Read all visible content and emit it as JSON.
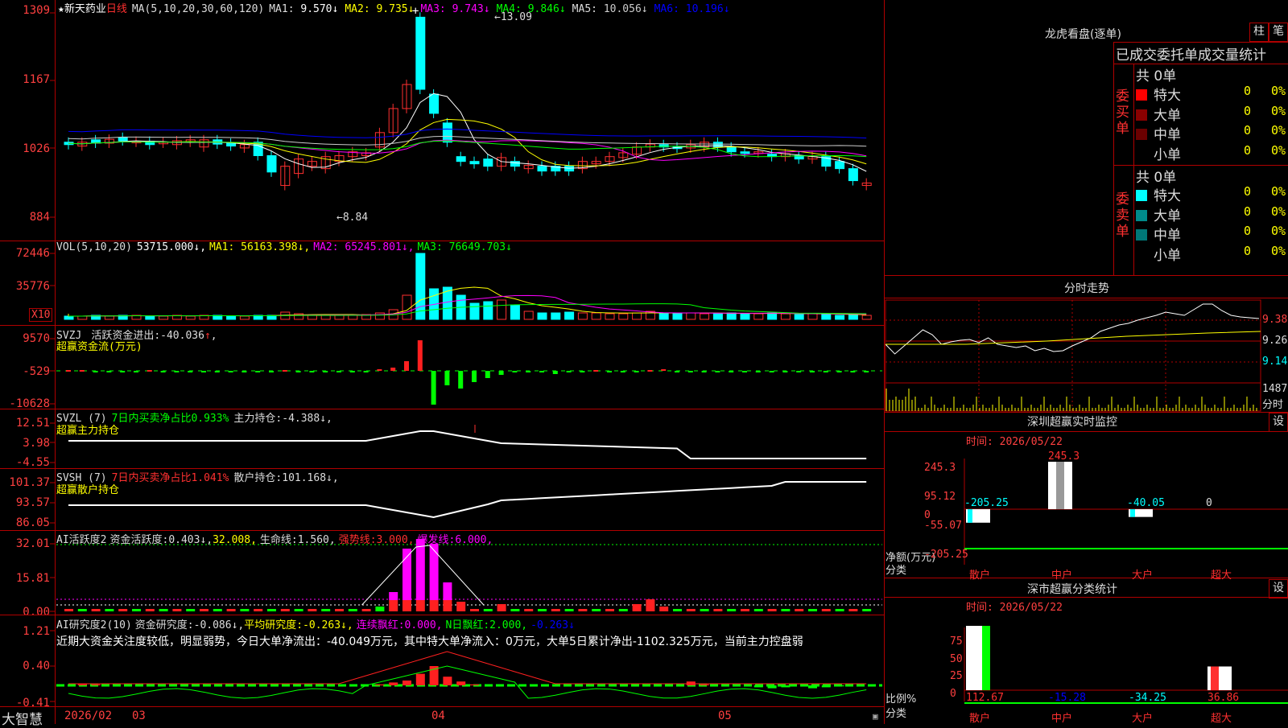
{
  "stock": {
    "star": "★",
    "name": "新天药业",
    "period": "日线"
  },
  "main_legend": {
    "ma_params": "MA(5,10,20,30,60,120)",
    "items": [
      {
        "label": "MA1:",
        "value": "9.570↓",
        "color": "#ffffff"
      },
      {
        "label": "MA2:",
        "value": "9.735↓",
        "color": "#ffff00"
      },
      {
        "label": "MA3:",
        "value": "9.743↓",
        "color": "#ff00ff"
      },
      {
        "label": "MA4:",
        "value": "9.846↓",
        "color": "#00ff00"
      },
      {
        "label": "MA5:",
        "value": "10.056↓",
        "color": "#cccccc"
      },
      {
        "label": "MA6:",
        "value": "10.196↓",
        "color": "#0000ff"
      }
    ],
    "high_mark": "13.09",
    "low_mark": "8.84"
  },
  "main_axis": [
    "1309",
    "1167",
    "1026",
    "884"
  ],
  "vol_legend": {
    "params": "VOL(5,10,20)",
    "value": "53715.000↓,",
    "items": [
      {
        "label": "MA1:",
        "value": "56163.398↓,",
        "color": "#ffff00"
      },
      {
        "label": "MA2:",
        "value": "65245.801↓,",
        "color": "#ff00ff"
      },
      {
        "label": "MA3:",
        "value": "76649.703↓",
        "color": "#00ff00"
      }
    ]
  },
  "vol_axis": [
    "72446",
    "35776"
  ],
  "vol_multiplier": "X10",
  "svzj": {
    "name": "SVZJ",
    "label": "活跃资金进出:",
    "value": "-40.036",
    "arrow": "↑",
    "comma": ",",
    "title": "超赢资金流(万元)"
  },
  "svzj_axis": [
    "9570",
    "-529",
    "-10628"
  ],
  "svzl": {
    "name": "SVZL (7)",
    "ratio": "7日内买卖净占比0.933%",
    "label": "主力持仓:",
    "value": "-4.388↓,",
    "title": "超赢主力持仓"
  },
  "svzl_axis": [
    "12.51",
    "3.98",
    "-4.55"
  ],
  "svsh": {
    "name": "SVSH (7)",
    "ratio": "7日内买卖净占比1.041%",
    "label": "散户持仓:",
    "value": "101.168↓,",
    "title": "超赢散户持仓"
  },
  "svsh_axis": [
    "101.37",
    "93.57",
    "86.05"
  ],
  "ai_active": {
    "name": "AI活跃度2",
    "label": "资金活跃度:",
    "value": "0.403↓,",
    "v2": "32.008,",
    "life_label": "生命线:",
    "life_value": "1.560,",
    "strong_label": "强势线:",
    "strong_value": "3.000,",
    "burst_label": "爆发线:",
    "burst_value": "6.000,"
  },
  "ai_active_axis": [
    "32.01",
    "15.81",
    "0.00"
  ],
  "ai_research": {
    "name": "AI研究度2(10)",
    "label": "资金研究度:",
    "value": "-0.086↓,",
    "avg_label": "平均研究度:",
    "avg_value": "-0.263↓,",
    "red_label": "连续飘红:",
    "red_value": "0.000,",
    "nred_label": "N日飘红:",
    "nred_value": "2.000,",
    "last": "-0.263↓",
    "comment": "近期大资金关注度较低，明显弱势，今日大单净流出：-40.049万元，其中特大单净流入：0万元，大单5日累计净出-1102.325万元，当前主力控盘弱"
  },
  "ai_research_axis": [
    "1.21",
    "0.40",
    "-0.41"
  ],
  "bottom": {
    "brand": "大智慧",
    "dates": [
      "2026/02",
      "03",
      "04",
      "05"
    ]
  },
  "dragon": {
    "title": "龙虎看盘(逐单)",
    "btn1": "柱",
    "btn2": "笔",
    "subtitle": "已成交委托单成交量统计",
    "buy_label": "委买单",
    "sell_label": "委卖单",
    "buy_total": "共 0单",
    "sell_total": "共 0单",
    "buy_rows": [
      {
        "name": "特大",
        "qty": "0",
        "pct": "0%",
        "color": "#ff0000"
      },
      {
        "name": "大单",
        "qty": "0",
        "pct": "0%",
        "color": "#8b0000"
      },
      {
        "name": "中单",
        "qty": "0",
        "pct": "0%",
        "color": "#6b0000"
      },
      {
        "name": "小单",
        "qty": "0",
        "pct": "0%",
        "color": ""
      }
    ],
    "sell_rows": [
      {
        "name": "特大",
        "qty": "0",
        "pct": "0%",
        "color": "#00ffff"
      },
      {
        "name": "大单",
        "qty": "0",
        "pct": "0%",
        "color": "#008b8b"
      },
      {
        "name": "中单",
        "qty": "0",
        "pct": "0%",
        "color": "#007777"
      },
      {
        "name": "小单",
        "qty": "0",
        "pct": "0%",
        "color": ""
      }
    ]
  },
  "intraday": {
    "title": "分时走势",
    "prices": [
      "9.38",
      "9.26",
      "9.14"
    ],
    "vol": "1487",
    "unit": "分时"
  },
  "monitor": {
    "title": "深圳超赢实时监控",
    "btn": "设",
    "date": "时间: 2026/05/22",
    "axis": [
      "245.3",
      "95.12",
      "0",
      "-55.07",
      "-205.25"
    ],
    "ylabel": "净额(万元)",
    "xlabel": "分类",
    "cats": [
      "散户",
      "中户",
      "大户",
      "超大"
    ],
    "values": [
      -205.25,
      245.3,
      -40.05,
      0
    ],
    "labels": [
      "-205.25",
      "245.3",
      "-40.05",
      "0"
    ]
  },
  "classify": {
    "title": "深市超赢分类统计",
    "btn": "设",
    "date": "时间: 2026/05/22",
    "axis": [
      "75",
      "50",
      "25",
      "0"
    ],
    "ylabel": "比例%",
    "xlabel": "分类",
    "cats": [
      "散户",
      "中户",
      "大户",
      "超大"
    ],
    "values": [
      112.67,
      -15.28,
      -34.25,
      36.86
    ],
    "labels": [
      "112.67",
      "-15.28",
      "-34.25",
      "36.86"
    ]
  }
}
